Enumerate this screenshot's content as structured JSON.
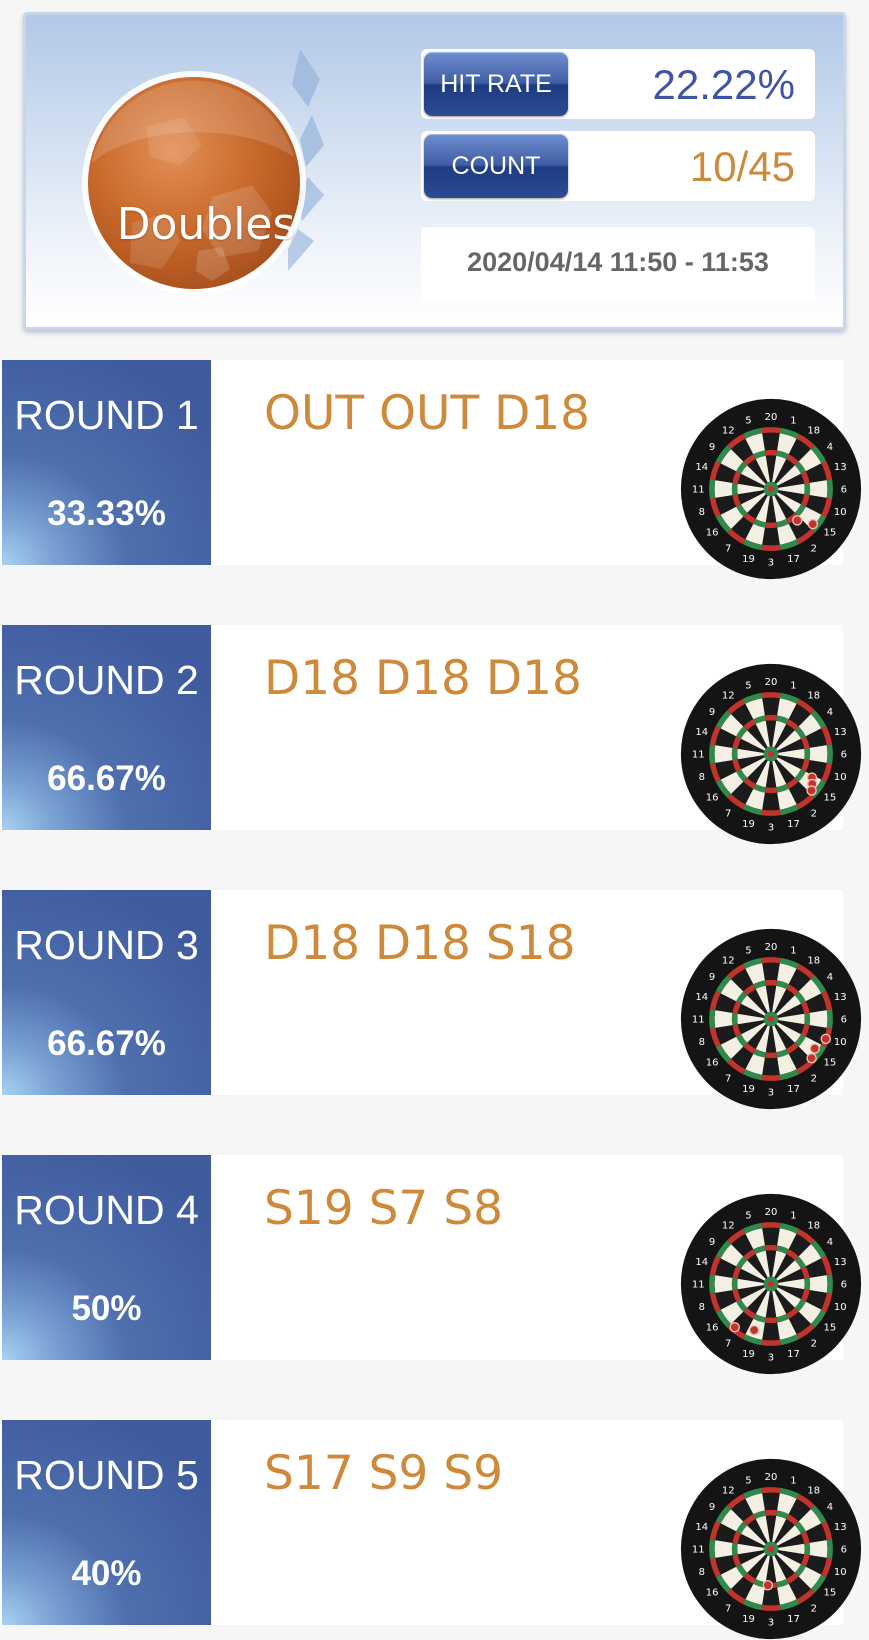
{
  "header": {
    "mode_title": "Doubles",
    "hit_rate_label": "HIT RATE",
    "hit_rate_value": "22.22%",
    "count_label": "COUNT",
    "count_value": "10/45",
    "session_time": "2020/04/14 11:50 - 11:53"
  },
  "colors": {
    "badge_orange": "#c8692b",
    "tile_blue": "#3f5b9e",
    "throw_text": "#cd8a3a",
    "hit_rate_value": "#3f54a3",
    "count_value": "#cd8a3a"
  },
  "rounds": [
    {
      "name": "ROUND 1",
      "rate": "33.33%",
      "throws": "OUT OUT D18"
    },
    {
      "name": "ROUND 2",
      "rate": "66.67%",
      "throws": "D18 D18 D18"
    },
    {
      "name": "ROUND 3",
      "rate": "66.67%",
      "throws": "D18 D18 S18"
    },
    {
      "name": "ROUND 4",
      "rate": "50%",
      "throws": "S19 S7 S8"
    },
    {
      "name": "ROUND 5",
      "rate": "40%",
      "throws": "S17 S9 S9"
    }
  ],
  "dartboard": {
    "numbers": [
      "20",
      "1",
      "18",
      "4",
      "13",
      "6",
      "10",
      "15",
      "2",
      "17",
      "3",
      "19",
      "7",
      "16",
      "8",
      "11",
      "14",
      "9",
      "12",
      "5"
    ],
    "icon": "dartboard-icon",
    "dart_marker_icon": "dart-hit-marker-icon"
  }
}
